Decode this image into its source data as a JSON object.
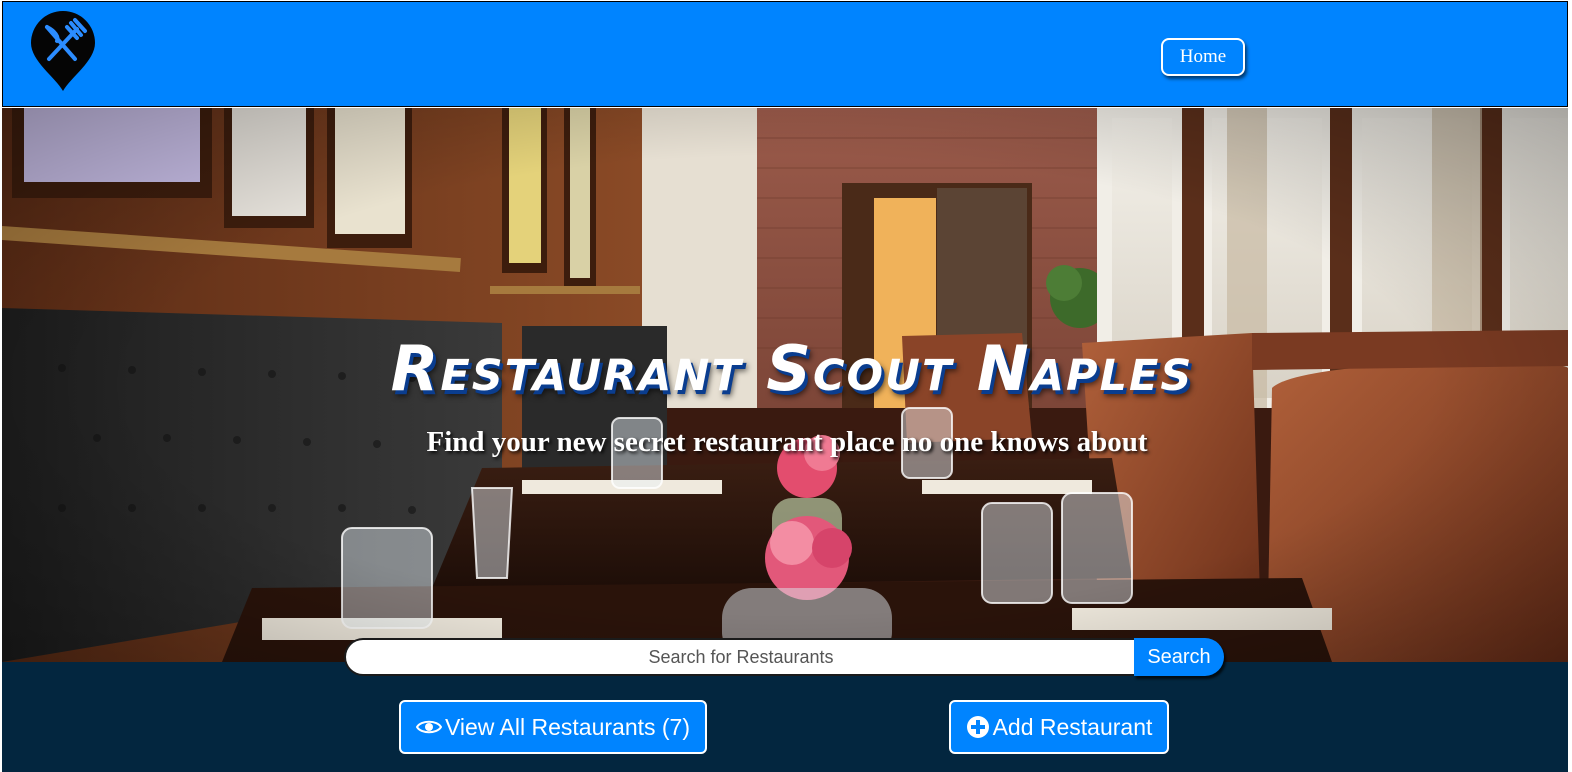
{
  "navbar": {
    "logo_icon": "map-pin-fork-knife-icon",
    "home_label": "Home",
    "bg_color": "#0084ff"
  },
  "hero": {
    "title": "Restaurant Scout Naples",
    "subtitle": "Find your new secret restaurant place no one knows about",
    "image": "restaurant-interior-photo"
  },
  "search": {
    "placeholder": "Search for Restaurants",
    "value": "",
    "button_label": "Search"
  },
  "actions": {
    "view_all": {
      "icon": "eye-icon",
      "label": "View All Restaurants (7)"
    },
    "add": {
      "icon": "plus-circle-icon",
      "label": "Add Restaurant"
    },
    "bg_color": "#03263f",
    "button_color": "#0084ff"
  }
}
